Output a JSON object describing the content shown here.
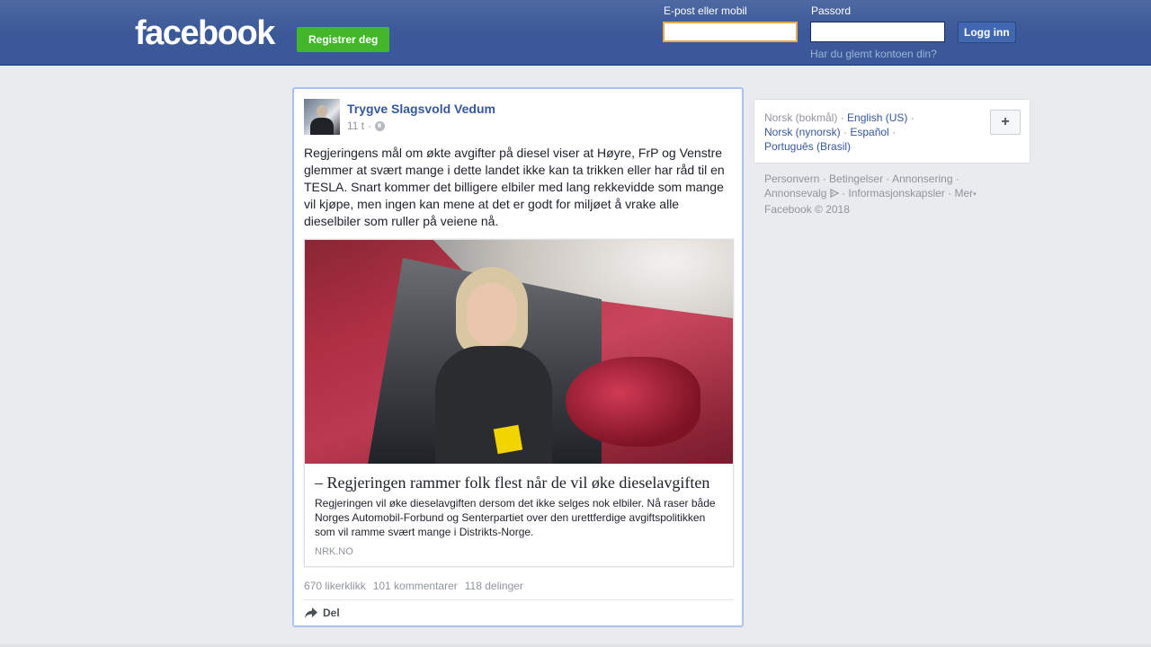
{
  "header": {
    "logo_text": "facebook",
    "register_label": "Registrer deg",
    "email_label": "E-post eller mobil",
    "email_value": "",
    "password_label": "Passord",
    "password_value": "",
    "login_label": "Logg inn",
    "forgot_link": "Har du glemt kontoen din?"
  },
  "post": {
    "author": "Trygve Slagsvold Vedum",
    "time": "11 t",
    "separator": "·",
    "privacy_icon": "globe-icon",
    "text": "Regjeringens mål om økte avgifter på diesel viser at Høyre, FrP og Venstre glemmer at svært mange i dette landet ikke kan ta trikken eller har råd til en TESLA. Snart kommer det billigere elbiler med lang rekkevidde som mange vil kjøpe, men ingen kan mene at det er godt for miljøet å vrake alle dieselbiler som ruller på veiene nå.",
    "link": {
      "title": "– Regjeringen rammer folk flest når de vil øke dieselavgiften",
      "description": "Regjeringen vil øke dieselavgiften dersom det ikke selges nok elbiler. Nå raser både Norges Automobil-Forbund og Senterpartiet over den urettferdige avgiftspolitikken som vil ramme svært mange i Distrikts-Norge.",
      "source": "NRK.NO"
    },
    "stats": {
      "likes": "670 likerklikk",
      "comments": "101 kommentarer",
      "shares": "118 delinger"
    },
    "share_label": "Del"
  },
  "sidebar": {
    "languages": {
      "current": "Norsk (bokmål)",
      "options": [
        "English (US)",
        "Norsk (nynorsk)",
        "Español",
        "Português (Brasil)"
      ],
      "add_label": "+"
    },
    "footer": {
      "links": [
        "Personvern",
        "Betingelser",
        "Annonsering",
        "Annonsevalg",
        "Informasjonskapsler",
        "Mer"
      ],
      "copyright": "Facebook © 2018"
    }
  },
  "colors": {
    "brand_blue": "#3b5998",
    "register_green": "#42b72a",
    "link_blue": "#365899",
    "muted_gray": "#90949c"
  }
}
